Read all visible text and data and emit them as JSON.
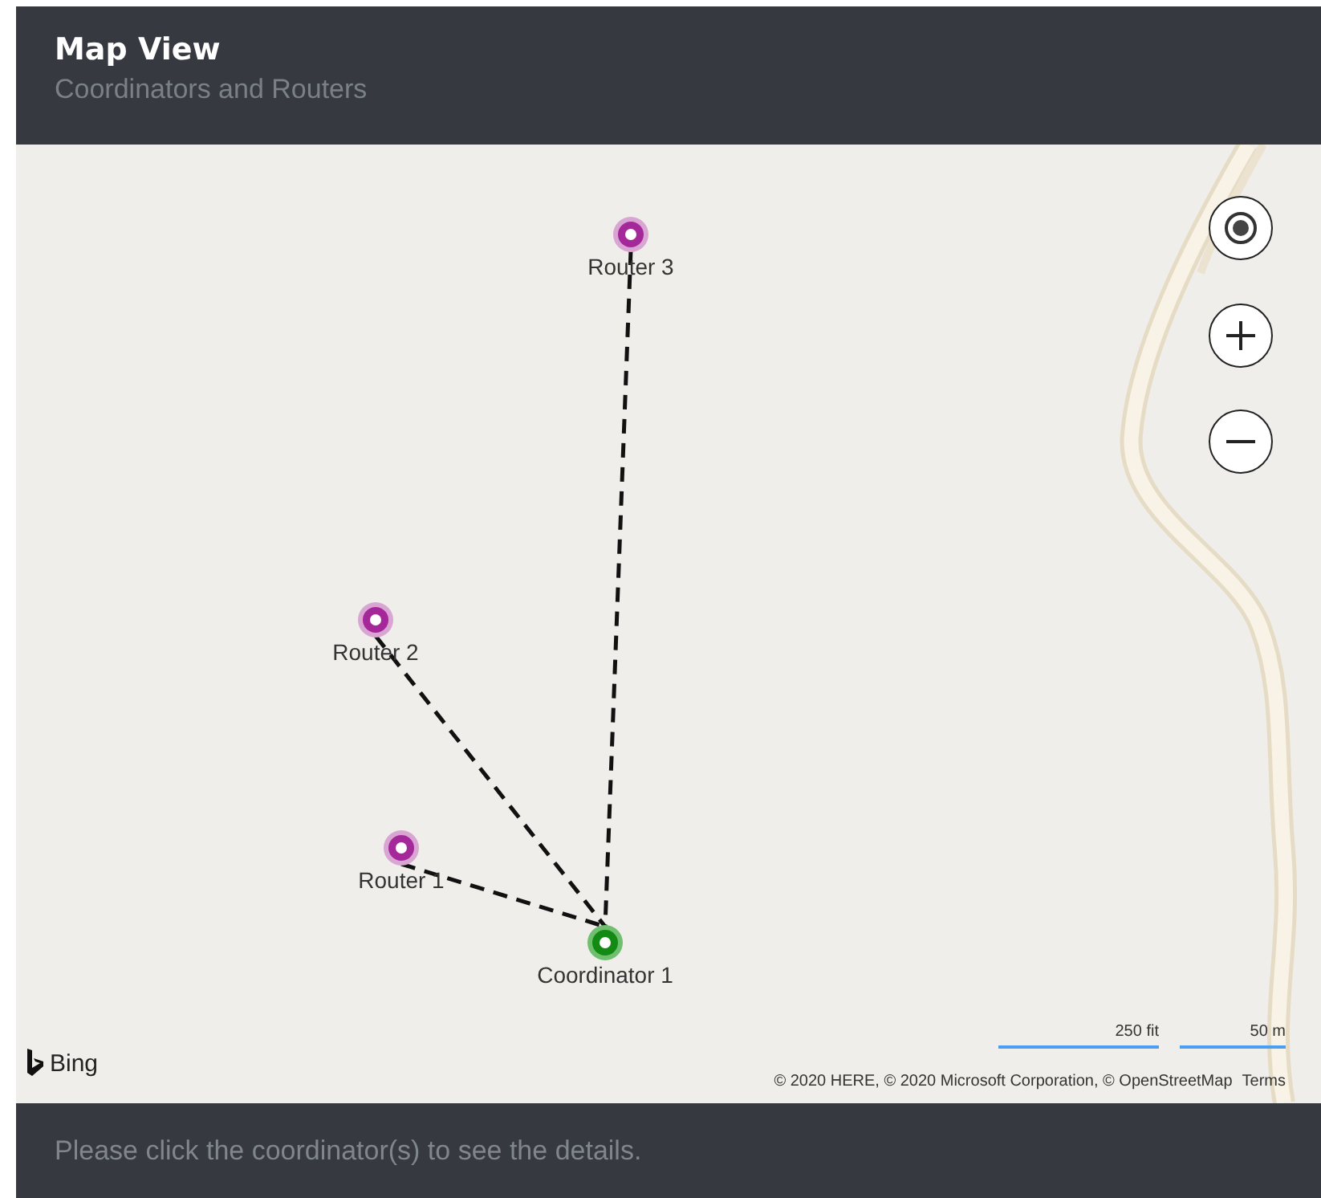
{
  "header": {
    "title": "Map View",
    "subtitle": "Coordinators and Routers"
  },
  "map": {
    "nodes": [
      {
        "kind": "router",
        "label": "Router 3"
      },
      {
        "kind": "router",
        "label": "Router 2"
      },
      {
        "kind": "router",
        "label": "Router 1"
      },
      {
        "kind": "coordinator",
        "label": "Coordinator 1"
      }
    ],
    "brand": "Bing",
    "scale": [
      "250 fit",
      "50 m"
    ],
    "copyright": "© 2020 HERE, © 2020 Microsoft Corporation, © OpenStreetMap",
    "terms": "Terms"
  },
  "footer": {
    "hint": "Please click the coordinator(s) to see the details."
  }
}
